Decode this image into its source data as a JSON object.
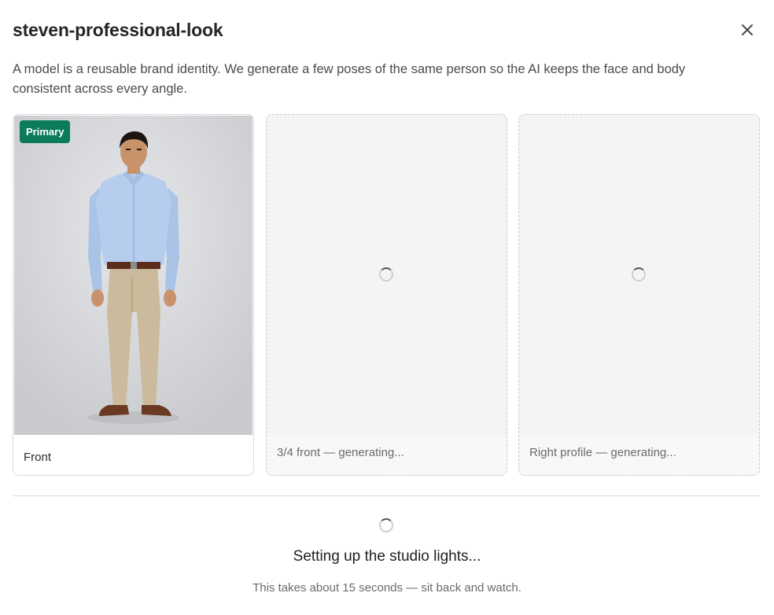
{
  "modal": {
    "title": "steven-professional-look",
    "description": "A model is a reusable brand identity. We generate a few poses of the same person so the AI keeps the face and body consistent across every angle."
  },
  "poses": [
    {
      "label": "Front",
      "badge": "Primary",
      "state": "done"
    },
    {
      "label": "3/4 front — generating...",
      "state": "generating"
    },
    {
      "label": "Right profile — generating...",
      "state": "generating"
    }
  ],
  "status": {
    "title": "Setting up the studio lights...",
    "subtitle": "This takes about 15 seconds — sit back and watch."
  },
  "colors": {
    "primary_badge": "#0b7b5a",
    "pending_card_bg": "#f4f4f4"
  },
  "icons": {
    "close": "close-icon",
    "loading": "spinner-icon"
  }
}
